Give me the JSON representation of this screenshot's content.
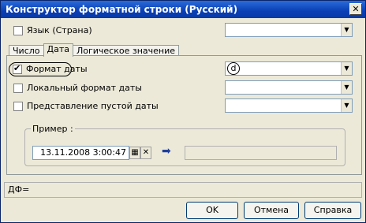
{
  "window": {
    "title": "Конструктор форматной строки (Русский)",
    "close_glyph": "✕"
  },
  "language": {
    "label": "Язык (Страна)",
    "checked": false,
    "value": ""
  },
  "tabs": [
    {
      "label": "Число",
      "active": false
    },
    {
      "label": "Дата",
      "active": true
    },
    {
      "label": "Логическое значение",
      "active": false
    }
  ],
  "date_tab": {
    "date_format": {
      "label": "Формат даты",
      "checked": true,
      "value": "d"
    },
    "local_format": {
      "label": "Локальный формат даты",
      "checked": false,
      "value": ""
    },
    "empty_date": {
      "label": "Представление пустой даты",
      "checked": false,
      "value": ""
    },
    "example": {
      "label": "Пример :",
      "date_value": "13.11.2008  3:00:47",
      "result": ""
    }
  },
  "df_line": "ДФ=",
  "buttons": {
    "ok": "OK",
    "cancel": "Отмена",
    "help": "Справка"
  },
  "icons": {
    "dropdown": "▼",
    "calendar": "▦",
    "clear": "✕",
    "arrow": "➡"
  }
}
